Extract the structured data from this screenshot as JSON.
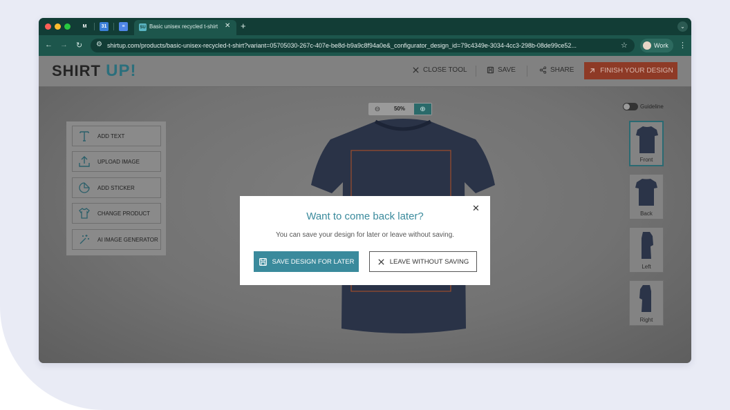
{
  "browser": {
    "tab_title": "Basic unisex recycled t-shirt",
    "tab_favicon_text": "SU",
    "pinned_tabs": [
      {
        "name": "gmail",
        "glyph": "M",
        "color": "#d9463b"
      },
      {
        "name": "calendar",
        "glyph": "31",
        "color": "#3b7fd9"
      },
      {
        "name": "docs",
        "glyph": "≡",
        "color": "#4f86e8"
      }
    ],
    "url": "shirtup.com/products/basic-unisex-recycled-t-shirt?variant=05705030-267c-407e-be8d-b9a9c8f94a0e&_configurator_design_id=79c4349e-3034-4cc3-298b-08de99ce52...",
    "profile_label": "Work"
  },
  "header": {
    "logo_text": "SHIRT",
    "logo_accent": "UP!",
    "close_tool": "CLOSE TOOL",
    "save": "SAVE",
    "share": "SHARE",
    "finish": "FINISH YOUR DESIGN"
  },
  "zoom": {
    "value": "50%"
  },
  "tools": [
    {
      "label": "ADD TEXT",
      "icon": "text-icon"
    },
    {
      "label": "UPLOAD IMAGE",
      "icon": "upload-icon"
    },
    {
      "label": "ADD STICKER",
      "icon": "sticker-icon"
    },
    {
      "label": "CHANGE PRODUCT",
      "icon": "tshirt-icon"
    },
    {
      "label": "AI IMAGE GENERATOR",
      "icon": "magic-wand-icon"
    }
  ],
  "guideline": {
    "label": "Guideline",
    "enabled": false
  },
  "views": [
    {
      "label": "Front",
      "active": true
    },
    {
      "label": "Back",
      "active": false
    },
    {
      "label": "Left",
      "active": false
    },
    {
      "label": "Right",
      "active": false
    }
  ],
  "modal": {
    "title": "Want to come back later?",
    "subtitle": "You can save your design for later or leave without saving.",
    "save_button": "SAVE DESIGN FOR LATER",
    "leave_button": "LEAVE WITHOUT SAVING"
  },
  "colors": {
    "brand_teal": "#3a8a9c",
    "finish_red": "#c2482e",
    "shirt_navy": "#2c3852"
  }
}
